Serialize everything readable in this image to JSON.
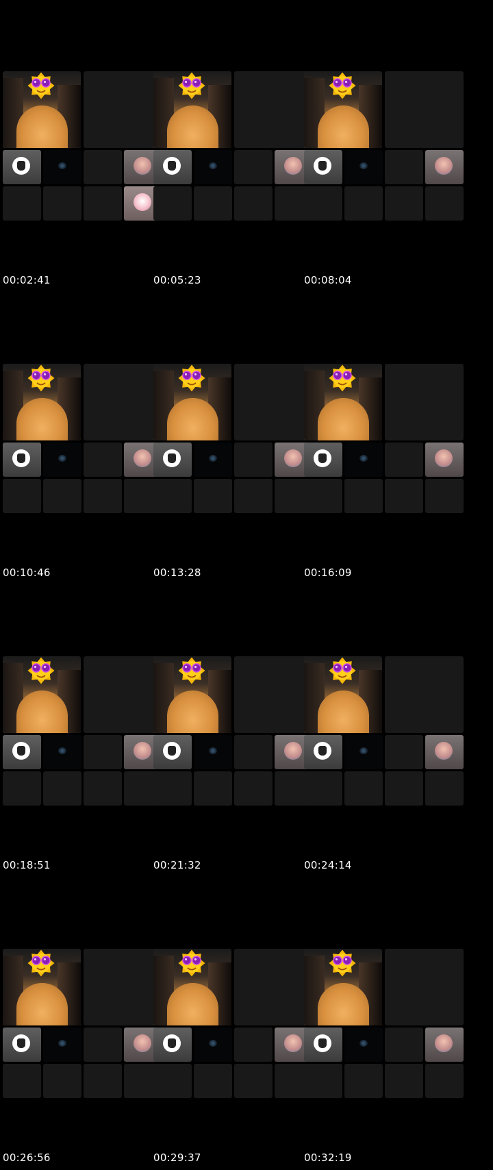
{
  "thumbnails": [
    {
      "timestamp": "00:02:41",
      "extra_avatar": true
    },
    {
      "timestamp": "00:05:23",
      "extra_avatar": false
    },
    {
      "timestamp": "00:08:04",
      "extra_avatar": false
    },
    {
      "timestamp": "00:10:46",
      "extra_avatar": false
    },
    {
      "timestamp": "00:13:28",
      "extra_avatar": false
    },
    {
      "timestamp": "00:16:09",
      "extra_avatar": false
    },
    {
      "timestamp": "00:18:51",
      "extra_avatar": false
    },
    {
      "timestamp": "00:21:32",
      "extra_avatar": false
    },
    {
      "timestamp": "00:24:14",
      "extra_avatar": false
    },
    {
      "timestamp": "00:26:56",
      "extra_avatar": false
    },
    {
      "timestamp": "00:29:37",
      "extra_avatar": false
    },
    {
      "timestamp": "00:32:19",
      "extra_avatar": false
    }
  ],
  "colors": {
    "background": "#000000",
    "tile": "#191919",
    "timestamp_text": "#ffffff"
  },
  "icons": {
    "face_cover": "sun-emoji-sunglasses-icon",
    "avatar_1": "cat-avatar-icon",
    "avatar_2": "anime-girl-avatar-icon",
    "avatar_3": "pink-character-avatar-icon"
  }
}
